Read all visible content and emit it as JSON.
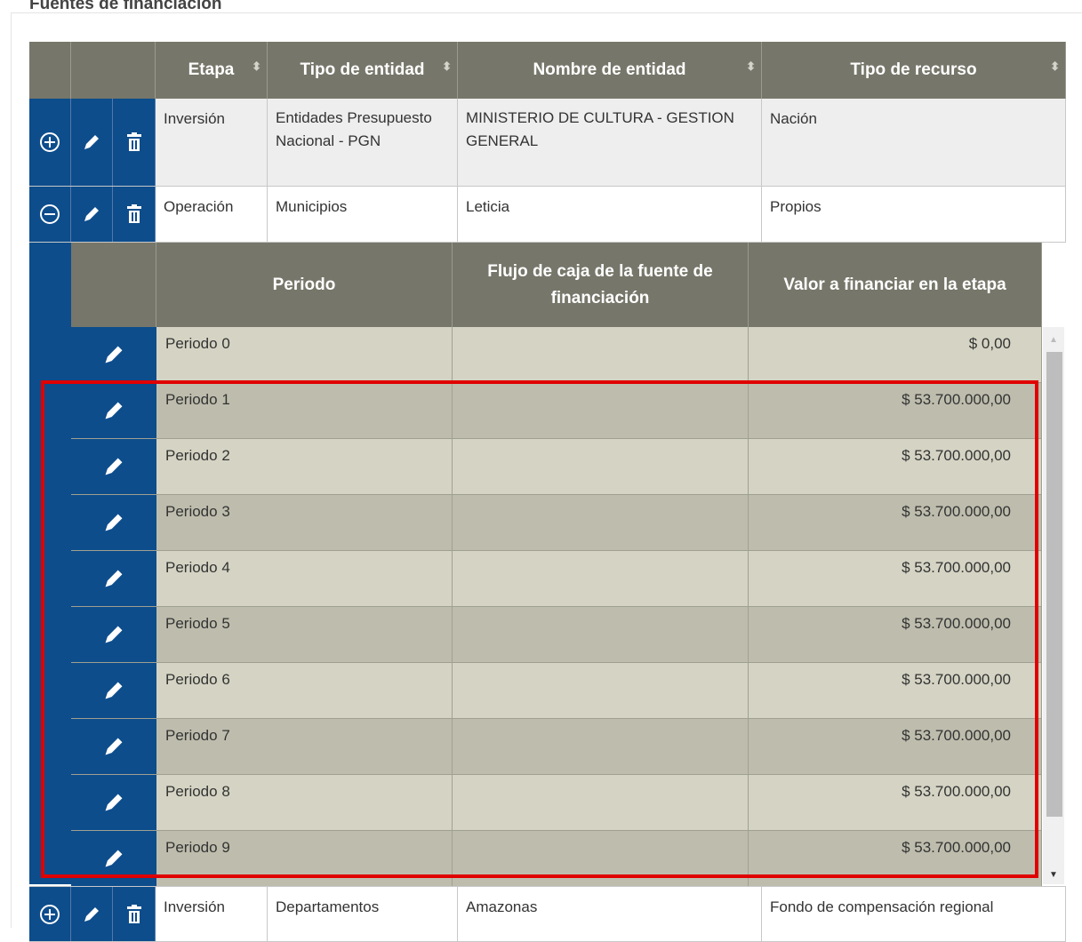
{
  "section_title": "Fuentes de financiación",
  "outer_headers": {
    "etapa": "Etapa",
    "tipo_entidad": "Tipo de entidad",
    "nombre_entidad": "Nombre de entidad",
    "tipo_recurso": "Tipo de recurso"
  },
  "rows": [
    {
      "etapa": "Inversión",
      "tipo_entidad": "Entidades Presupuesto Nacional - PGN",
      "nombre_entidad": "MINISTERIO DE CULTURA - GESTION GENERAL",
      "tipo_recurso": "Nación",
      "expanded": false
    },
    {
      "etapa": "Operación",
      "tipo_entidad": "Municipios",
      "nombre_entidad": "Leticia",
      "tipo_recurso": "Propios",
      "expanded": true
    },
    {
      "etapa": "Inversión",
      "tipo_entidad": "Departamentos",
      "nombre_entidad": "Amazonas",
      "tipo_recurso": "Fondo  de compensación regional",
      "expanded": false
    }
  ],
  "inner_headers": {
    "periodo": "Periodo",
    "flujo": "Flujo de caja de la fuente de financiación",
    "valor": "Valor a financiar en la etapa"
  },
  "periods": [
    {
      "periodo": "Periodo 0",
      "flujo": "",
      "valor": "$ 0,00"
    },
    {
      "periodo": "Periodo 1",
      "flujo": "",
      "valor": "$ 53.700.000,00"
    },
    {
      "periodo": "Periodo 2",
      "flujo": "",
      "valor": "$ 53.700.000,00"
    },
    {
      "periodo": "Periodo 3",
      "flujo": "",
      "valor": "$ 53.700.000,00"
    },
    {
      "periodo": "Periodo 4",
      "flujo": "",
      "valor": "$ 53.700.000,00"
    },
    {
      "periodo": "Periodo 5",
      "flujo": "",
      "valor": "$ 53.700.000,00"
    },
    {
      "periodo": "Periodo 6",
      "flujo": "",
      "valor": "$ 53.700.000,00"
    },
    {
      "periodo": "Periodo 7",
      "flujo": "",
      "valor": "$ 53.700.000,00"
    },
    {
      "periodo": "Periodo 8",
      "flujo": "",
      "valor": "$ 53.700.000,00"
    },
    {
      "periodo": "Periodo 9",
      "flujo": "",
      "valor": "$ 53.700.000,00"
    }
  ],
  "colors": {
    "header_bg": "#76766a",
    "control_blue": "#0d4d8c",
    "highlight_red": "#e00000"
  }
}
